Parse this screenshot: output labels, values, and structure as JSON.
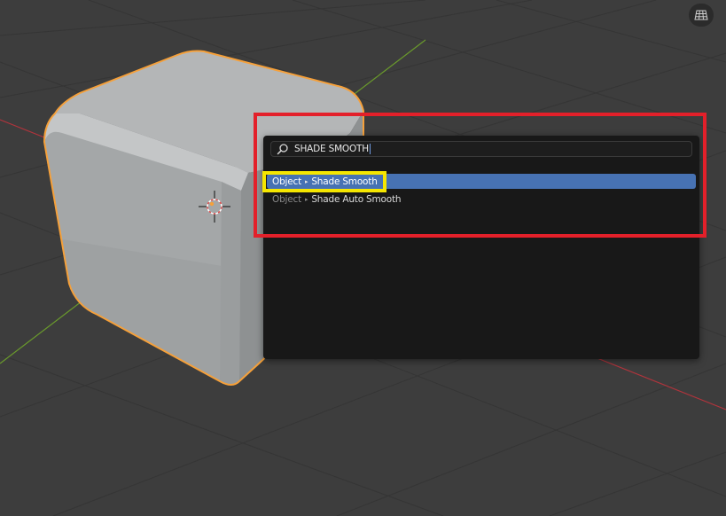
{
  "viewport": {
    "gizmo_icon": "wireframe-grid-icon"
  },
  "search": {
    "icon": "magnifier-icon",
    "query": "SHADE SMOOTH"
  },
  "results": [
    {
      "category": "Object",
      "separator": "▸",
      "label": "Shade Smooth",
      "selected": true
    },
    {
      "category": "Object",
      "separator": "▸",
      "label": "Shade Auto Smooth",
      "selected": false
    }
  ],
  "colors": {
    "selection_highlight": "#4772b3",
    "object_outline": "#f5a03a",
    "annotation_red": "#e3202a",
    "annotation_yellow": "#f5e600",
    "x_axis": "#b0343c",
    "y_axis": "#6a9a2c"
  }
}
